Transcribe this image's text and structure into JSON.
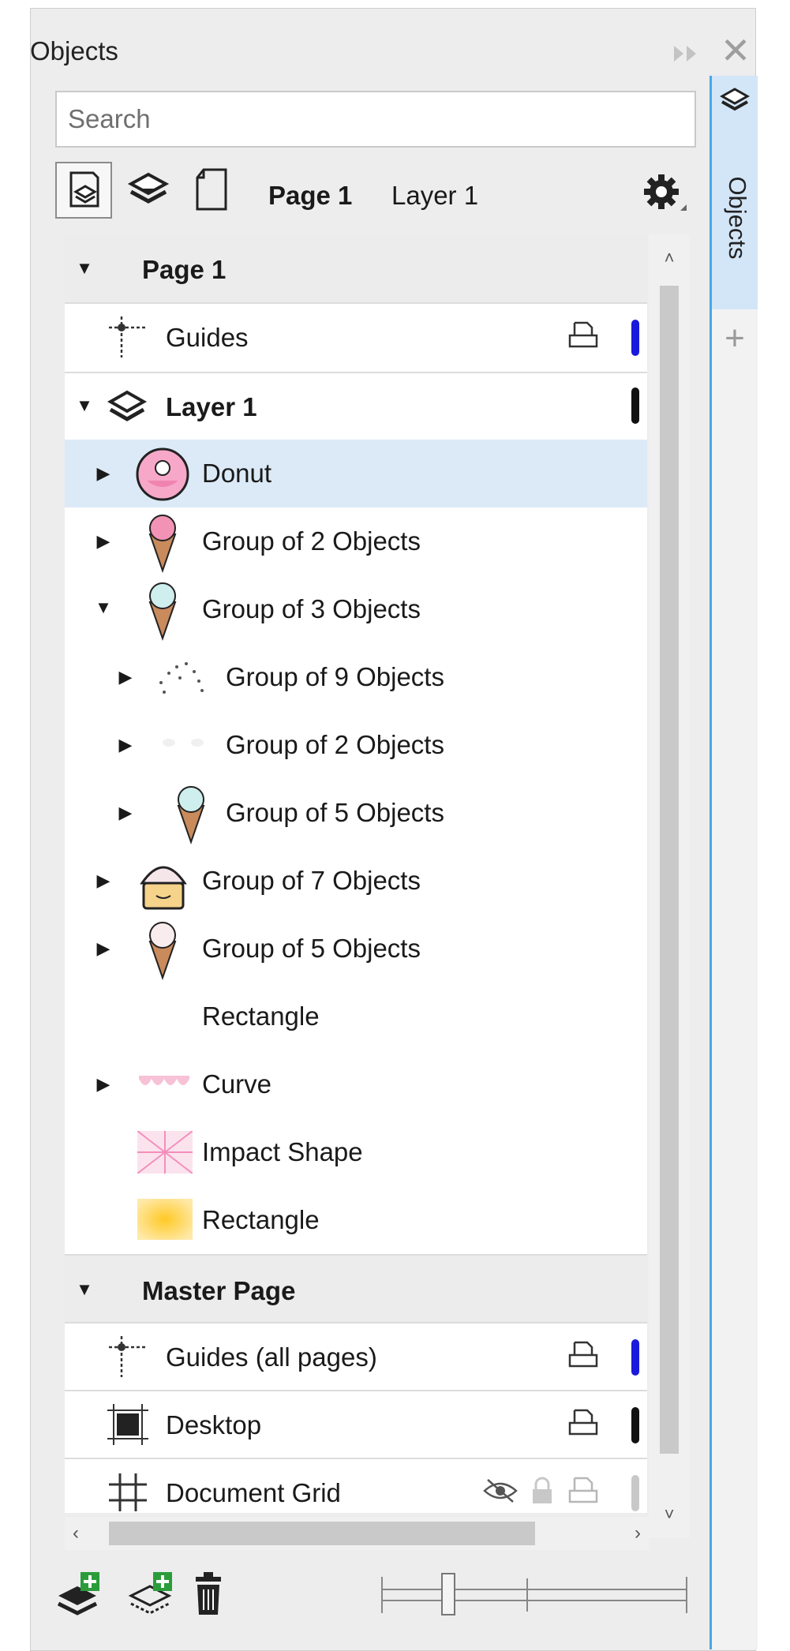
{
  "panel": {
    "title": "Objects",
    "expand_glyph": "⏵⏵",
    "close_glyph": "✕"
  },
  "search": {
    "placeholder": "Search"
  },
  "toolbar": {
    "icons": [
      "page-layers-view-icon",
      "layers-icon",
      "page-icon",
      "gear-icon"
    ],
    "breadcrumb_page": "Page 1",
    "breadcrumb_layer": "Layer 1"
  },
  "tree": {
    "page_header": "Page 1",
    "guides": "Guides",
    "layer": "Layer 1",
    "items": [
      {
        "label": "Donut"
      },
      {
        "label": "Group of 2 Objects"
      },
      {
        "label": "Group of 3 Objects"
      },
      {
        "label": "Group of 9 Objects"
      },
      {
        "label": "Group of 2 Objects"
      },
      {
        "label": "Group of 5 Objects"
      },
      {
        "label": "Group of 7 Objects"
      },
      {
        "label": "Group of 5 Objects"
      },
      {
        "label": "Rectangle"
      },
      {
        "label": "Curve"
      },
      {
        "label": "Impact Shape"
      },
      {
        "label": "Rectangle"
      }
    ],
    "master_header": "Master Page",
    "master_items": [
      {
        "label": "Guides (all pages)"
      },
      {
        "label": "Desktop"
      },
      {
        "label": "Document Grid"
      }
    ]
  },
  "colors": {
    "guides_color": "#1a1adc",
    "layer_color": "#111111",
    "desktop_color": "#111111",
    "grid_color": "#c8c8c8",
    "selected_row": "#dceaf7",
    "tab_accent": "#49a6e8"
  },
  "side_tab": {
    "label": "Objects",
    "add_glyph": "+"
  },
  "bottom_bar": {
    "icons": [
      "new-layer-icon",
      "new-master-layer-icon",
      "delete-icon"
    ]
  }
}
